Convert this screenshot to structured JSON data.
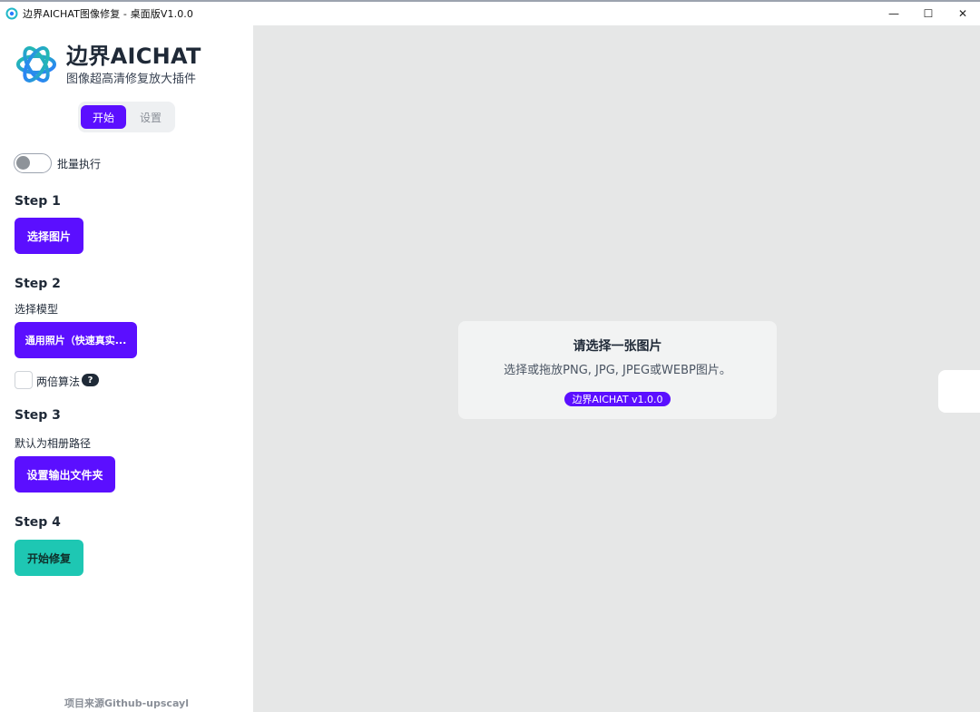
{
  "window": {
    "title": "边界AICHAT图像修复 - 桌面版V1.0.0",
    "controls": {
      "minimize": "—",
      "maximize": "☐",
      "close": "✕"
    }
  },
  "brand": {
    "name": "边界AICHAT",
    "subtitle": "图像超高清修复放大插件",
    "colors": {
      "accent": "#5b0fff",
      "teal": "#1ec7b3",
      "logo_gradient": [
        "#22c1a8",
        "#2b7cff"
      ]
    }
  },
  "tabs": [
    {
      "label": "开始",
      "active": true
    },
    {
      "label": "设置",
      "active": false
    }
  ],
  "batch": {
    "label": "批量执行",
    "enabled": false
  },
  "steps": [
    {
      "title": "Step 1",
      "button": "选择图片"
    },
    {
      "title": "Step 2",
      "hint": "选择模型",
      "button": "通用照片（快速真实...",
      "checkbox_label": "两倍算法",
      "checkbox_checked": false,
      "help": "?"
    },
    {
      "title": "Step 3",
      "hint": "默认为相册路径",
      "button": "设置输出文件夹"
    },
    {
      "title": "Step 4",
      "button": "开始修复"
    }
  ],
  "footer": "项目来源Github-upscayl",
  "main": {
    "title": "请选择一张图片",
    "subtitle": "选择或拖放PNG, JPG, JPEG或WEBP图片。",
    "version": "边界AICHAT v1.0.0"
  }
}
